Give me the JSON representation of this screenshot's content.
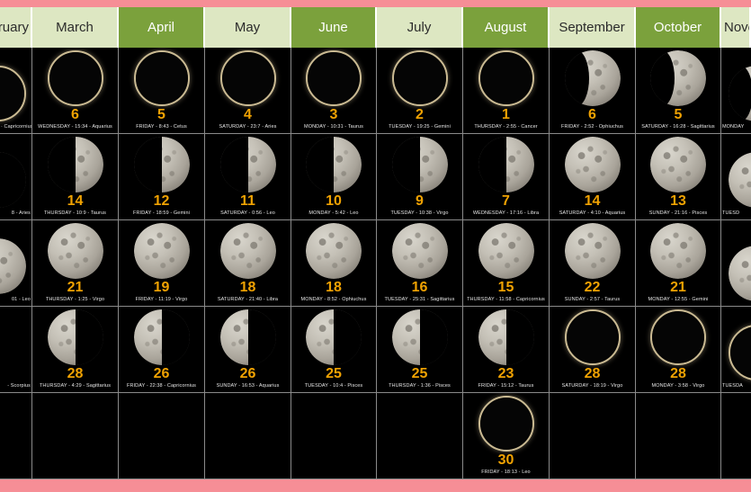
{
  "theme": {
    "rail_color": "#f68e96",
    "header_light": "#dde7c2",
    "header_dark": "#7ba13c",
    "day_number_color": "#f0a202",
    "background": "#000000",
    "grid_line_color": "#8a8a8a"
  },
  "columns": [
    {
      "month": "February",
      "header_style": "light",
      "clipped_left": true,
      "cells": [
        {
          "phase": "new",
          "day": "",
          "detail": "· Capricornius"
        },
        {
          "phase": "last",
          "day": "",
          "detail": "8 - Aries"
        },
        {
          "phase": "full",
          "day": "",
          "detail": "01 - Leo"
        },
        {
          "phase": "empty",
          "day": "",
          "detail": "- Scorpius"
        },
        {
          "phase": "empty",
          "day": "",
          "detail": ""
        }
      ]
    },
    {
      "month": "March",
      "header_style": "light",
      "clipped_left": false,
      "cells": [
        {
          "phase": "new",
          "day": "6",
          "detail": "WEDNESDAY  - 15:34 - Aquarius"
        },
        {
          "phase": "first",
          "day": "14",
          "detail": "THURSDAY  - 10:9 - Taurus"
        },
        {
          "phase": "full",
          "day": "21",
          "detail": "THURSDAY - 1:25 - Virgo"
        },
        {
          "phase": "last",
          "day": "28",
          "detail": "THURSDAY  - 4:29 - Sagittarius"
        },
        {
          "phase": "empty",
          "day": "",
          "detail": ""
        }
      ]
    },
    {
      "month": "April",
      "header_style": "dark",
      "clipped_left": false,
      "cells": [
        {
          "phase": "new",
          "day": "5",
          "detail": "FRIDAY  - 8:43 - Cetus"
        },
        {
          "phase": "first",
          "day": "12",
          "detail": "FRIDAY  - 18:59 - Gemini"
        },
        {
          "phase": "full",
          "day": "19",
          "detail": "FRIDAY  - 11:19 - Virgo"
        },
        {
          "phase": "last",
          "day": "26",
          "detail": "FRIDAY  - 22:38 - Capricornius"
        },
        {
          "phase": "empty",
          "day": "",
          "detail": ""
        }
      ]
    },
    {
      "month": "May",
      "header_style": "light",
      "clipped_left": false,
      "cells": [
        {
          "phase": "new",
          "day": "4",
          "detail": "SATURDAY  - 23:7 - Aries"
        },
        {
          "phase": "first",
          "day": "11",
          "detail": "SATURDAY  - 0:56 - Leo"
        },
        {
          "phase": "full",
          "day": "18",
          "detail": "SATURDAY  - 21:40 - Libra"
        },
        {
          "phase": "last",
          "day": "26",
          "detail": "SUNDAY  - 16:53 - Aquarius"
        },
        {
          "phase": "empty",
          "day": "",
          "detail": ""
        }
      ]
    },
    {
      "month": "June",
      "header_style": "dark",
      "clipped_left": false,
      "cells": [
        {
          "phase": "new",
          "day": "3",
          "detail": "MONDAY  - 10:31 - Taurus"
        },
        {
          "phase": "first",
          "day": "10",
          "detail": "MONDAY  - 5:42 - Leo"
        },
        {
          "phase": "full",
          "day": "18",
          "detail": "MONDAY  - 8:52 - Ophiuchus"
        },
        {
          "phase": "last",
          "day": "25",
          "detail": "TUESDAY  - 10:4 - Pisces"
        },
        {
          "phase": "empty",
          "day": "",
          "detail": ""
        }
      ]
    },
    {
      "month": "July",
      "header_style": "light",
      "clipped_left": false,
      "cells": [
        {
          "phase": "new",
          "day": "2",
          "detail": "TUESDAY  - 19:25 - Gemini"
        },
        {
          "phase": "first",
          "day": "9",
          "detail": "TUESDAY  - 10:38 - Virgo"
        },
        {
          "phase": "full",
          "day": "16",
          "detail": "TUESDAY - 25:31 - Sagittarius"
        },
        {
          "phase": "last",
          "day": "25",
          "detail": "THURSDAY - 1:36 - Pisces"
        },
        {
          "phase": "empty",
          "day": "",
          "detail": ""
        }
      ]
    },
    {
      "month": "August",
      "header_style": "dark",
      "clipped_left": false,
      "cells": [
        {
          "phase": "new",
          "day": "1",
          "detail": "THURSDAY - 2:55 - Cancer"
        },
        {
          "phase": "first",
          "day": "7",
          "detail": "WEDNESDAY  - 17:16 - Libra"
        },
        {
          "phase": "full",
          "day": "15",
          "detail": "THURSDAY  - 11:58 - Capricornius"
        },
        {
          "phase": "last",
          "day": "23",
          "detail": "FRIDAY  - 15:12 - Taurus"
        },
        {
          "phase": "new",
          "day": "30",
          "detail": "FRIDAY  - 18:13 - Leo"
        }
      ]
    },
    {
      "month": "September",
      "header_style": "light",
      "clipped_left": false,
      "cells": [
        {
          "phase": "waxing",
          "day": "6",
          "detail": "FRIDAY - 2:52 - Ophiuchus"
        },
        {
          "phase": "full",
          "day": "14",
          "detail": "SATURDAY  - 4:10 - Aquarius"
        },
        {
          "phase": "full",
          "day": "22",
          "detail": "SUNDAY - 2:57 - Taurus"
        },
        {
          "phase": "new",
          "day": "28",
          "detail": "SATURDAY  - 18:19 - Virgo"
        },
        {
          "phase": "empty",
          "day": "",
          "detail": ""
        }
      ]
    },
    {
      "month": "October",
      "header_style": "dark",
      "clipped_left": false,
      "cells": [
        {
          "phase": "waxing",
          "day": "5",
          "detail": "SATURDAY  - 16:28 - Sagittarius"
        },
        {
          "phase": "full",
          "day": "13",
          "detail": "SUNDAY  - 21:16 - Pisces"
        },
        {
          "phase": "full",
          "day": "21",
          "detail": "MONDAY  - 12:55 - Gemini"
        },
        {
          "phase": "new",
          "day": "28",
          "detail": "MONDAY  - 3:58 - Virgo"
        },
        {
          "phase": "empty",
          "day": "",
          "detail": ""
        }
      ]
    },
    {
      "month": "November",
      "header_style": "light",
      "clipped_right": true,
      "cells": [
        {
          "phase": "waxing",
          "day": "",
          "detail": "MONDAY"
        },
        {
          "phase": "full",
          "day": "",
          "detail": "TUESD"
        },
        {
          "phase": "full",
          "day": "",
          "detail": ""
        },
        {
          "phase": "new",
          "day": "",
          "detail": "TUESDA"
        },
        {
          "phase": "empty",
          "day": "",
          "detail": ""
        }
      ]
    }
  ]
}
